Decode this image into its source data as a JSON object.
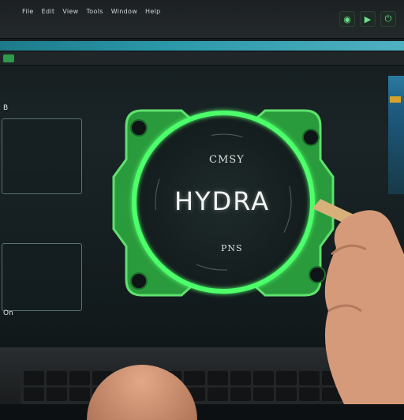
{
  "topbar": {
    "menu": [
      "File",
      "Edit",
      "View",
      "Tools",
      "Window",
      "Help"
    ],
    "buttons": [
      "◉",
      "▶",
      "⏻"
    ]
  },
  "status": {
    "text": ""
  },
  "subbar": {
    "items": [
      "",
      "",
      "",
      "",
      "",
      "",
      ""
    ]
  },
  "left": {
    "breadcrumb": "",
    "panel1": {
      "label": "B",
      "rows": [
        "",
        "",
        "",
        "",
        "",
        ""
      ]
    },
    "panel2": {
      "rows": [
        "",
        "",
        "",
        "",
        "",
        "",
        "",
        ""
      ]
    },
    "bottom_label": "On"
  },
  "logo": {
    "top_caption": "CMSY",
    "title": "HYDRA",
    "bottom_caption": "PNS",
    "accent": "#2fd24a",
    "glow": "#4dff6a"
  },
  "icons": {
    "logo": "hydra-logo-icon",
    "hand": "hand-icon"
  }
}
